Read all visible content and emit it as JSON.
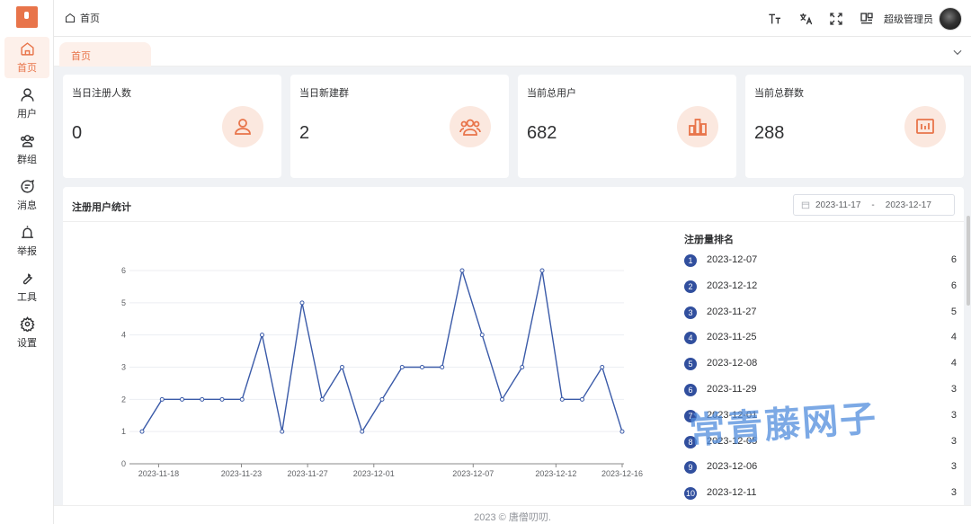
{
  "breadcrumb": {
    "home": "首页"
  },
  "header": {
    "username": "超级管理员"
  },
  "tabs": [
    {
      "label": "首页"
    }
  ],
  "sidebar": {
    "items": [
      {
        "label": "首页",
        "icon": "home-icon",
        "active": true
      },
      {
        "label": "用户",
        "icon": "user-icon"
      },
      {
        "label": "群组",
        "icon": "group-icon"
      },
      {
        "label": "消息",
        "icon": "message-icon"
      },
      {
        "label": "举报",
        "icon": "alarm-icon"
      },
      {
        "label": "工具",
        "icon": "wrench-icon"
      },
      {
        "label": "设置",
        "icon": "gear-icon"
      }
    ]
  },
  "stats": [
    {
      "label": "当日注册人数",
      "value": "0",
      "icon": "user-icon"
    },
    {
      "label": "当日新建群",
      "value": "2",
      "icon": "group-icon"
    },
    {
      "label": "当前总用户",
      "value": "682",
      "icon": "bar-chart-icon"
    },
    {
      "label": "当前总群数",
      "value": "288",
      "icon": "dashboard-icon"
    }
  ],
  "panel": {
    "title": "注册用户统计",
    "date_start": "2023-11-17",
    "date_sep": "-",
    "date_end": "2023-12-17"
  },
  "ranking": {
    "title": "注册量排名",
    "items": [
      {
        "rank": "1",
        "date": "2023-12-07",
        "count": "6"
      },
      {
        "rank": "2",
        "date": "2023-12-12",
        "count": "6"
      },
      {
        "rank": "3",
        "date": "2023-11-27",
        "count": "5"
      },
      {
        "rank": "4",
        "date": "2023-11-25",
        "count": "4"
      },
      {
        "rank": "5",
        "date": "2023-12-08",
        "count": "4"
      },
      {
        "rank": "6",
        "date": "2023-11-29",
        "count": "3"
      },
      {
        "rank": "7",
        "date": "2023-12-01",
        "count": "3"
      },
      {
        "rank": "8",
        "date": "2023-12-05",
        "count": "3"
      },
      {
        "rank": "9",
        "date": "2023-12-06",
        "count": "3"
      },
      {
        "rank": "10",
        "date": "2023-12-11",
        "count": "3"
      }
    ]
  },
  "watermark": "常青藤网子",
  "footer": "2023 © 唐僧叨叨.",
  "colors": {
    "accent": "#e8744a",
    "accent_bg": "#fbe8df",
    "line": "#3a5aa8",
    "rank_badge": "#314f9e"
  },
  "chart_data": {
    "type": "line",
    "x": [
      "2023-11-17",
      "2023-11-18",
      "2023-11-19",
      "2023-11-20",
      "2023-11-21",
      "2023-11-22",
      "2023-11-23",
      "2023-11-24",
      "2023-11-25",
      "2023-11-26",
      "2023-11-27",
      "2023-11-28",
      "2023-11-29",
      "2023-11-30",
      "2023-12-01",
      "2023-12-02",
      "2023-12-03",
      "2023-12-04",
      "2023-12-05",
      "2023-12-06",
      "2023-12-07",
      "2023-12-08",
      "2023-12-09",
      "2023-12-10",
      "2023-12-11",
      "2023-12-12",
      "2023-12-13",
      "2023-12-14",
      "2023-12-15",
      "2023-12-16"
    ],
    "values": [
      1,
      2,
      2,
      2,
      2,
      2,
      4,
      1,
      5,
      2,
      3,
      1,
      2,
      3,
      3,
      3,
      6,
      4,
      2,
      3,
      6,
      2,
      2,
      3,
      1
    ],
    "xticks": [
      "2023-11-18",
      "2023-11-23",
      "2023-11-27",
      "2023-12-01",
      "2023-12-07",
      "2023-12-12",
      "2023-12-16"
    ],
    "yticks": [
      "0",
      "1",
      "2",
      "3",
      "4",
      "5",
      "6"
    ],
    "ylim": [
      0,
      6
    ],
    "grid": true,
    "legend": "none"
  }
}
